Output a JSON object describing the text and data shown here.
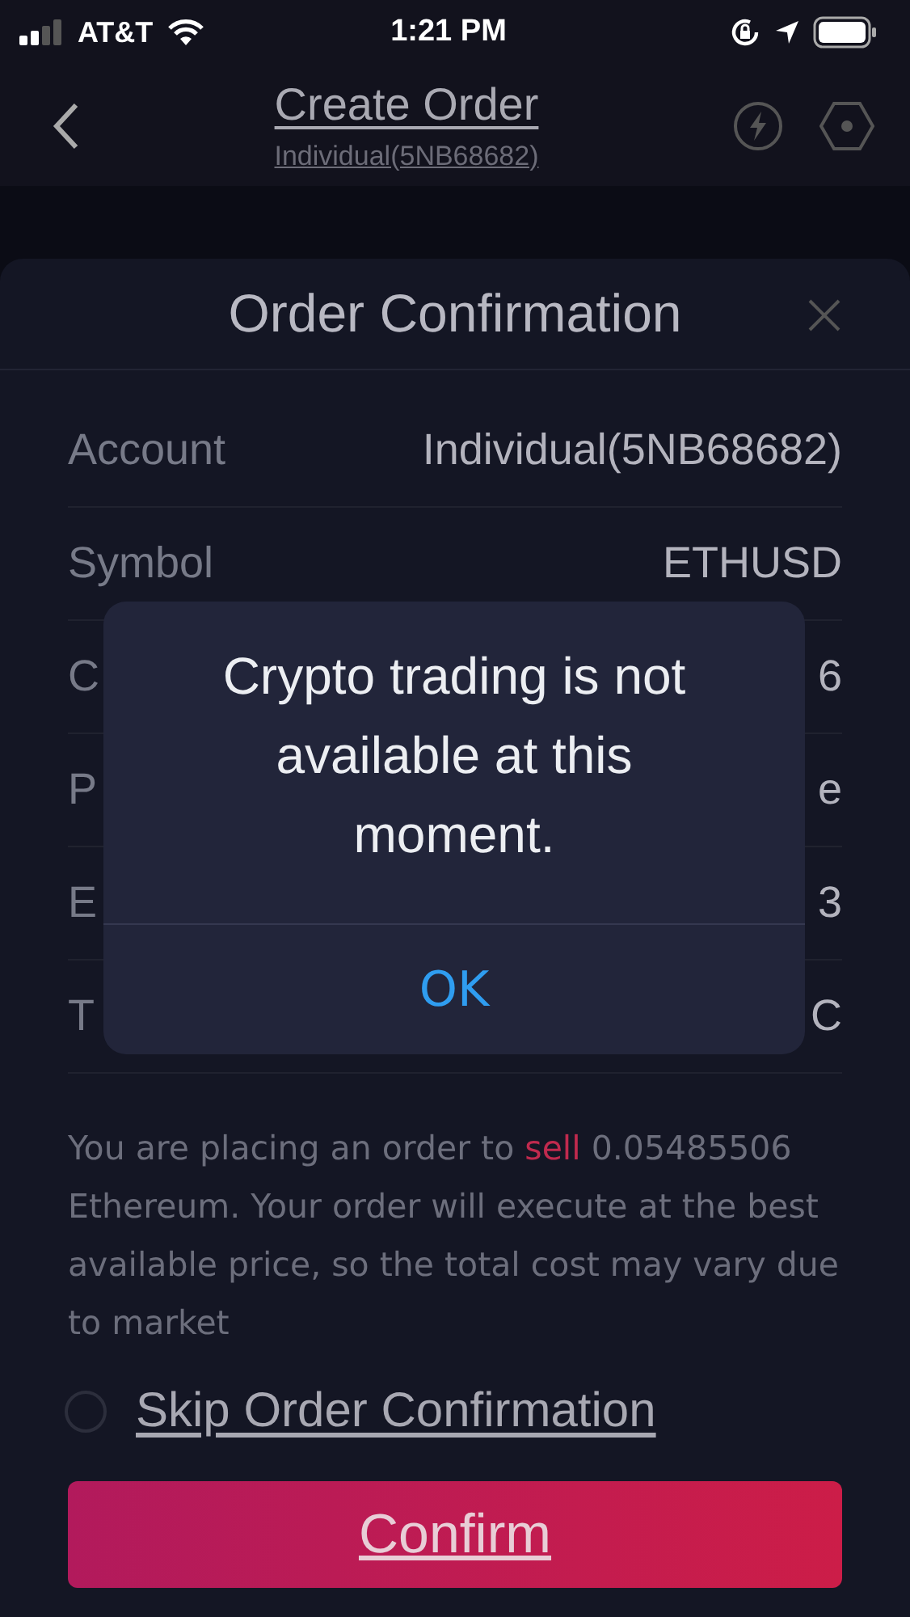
{
  "status_bar": {
    "carrier": "AT&T",
    "time": "1:21 PM"
  },
  "header": {
    "title": "Create Order",
    "subtitle": "Individual(5NB68682)"
  },
  "sheet": {
    "title": "Order Confirmation",
    "rows": [
      {
        "label": "Account",
        "value": "Individual(5NB68682)"
      },
      {
        "label": "Symbol",
        "value": "ETHUSD"
      },
      {
        "label": "C",
        "value": "6"
      },
      {
        "label": "P",
        "value": "e"
      },
      {
        "label": "E",
        "value": "3"
      },
      {
        "label": "T",
        "value": "C"
      }
    ],
    "summary": {
      "before": "You are placing an order to ",
      "action": "sell",
      "after": " 0.05485506 Ethereum. Your order will execute at the best available price, so the total cost may vary due to market"
    },
    "skip_option": {
      "label": "Skip Order Confirmation",
      "checked": false
    },
    "confirm_button": "Confirm"
  },
  "alert": {
    "message": "Crypto trading is not available at this moment.",
    "button": "OK"
  }
}
